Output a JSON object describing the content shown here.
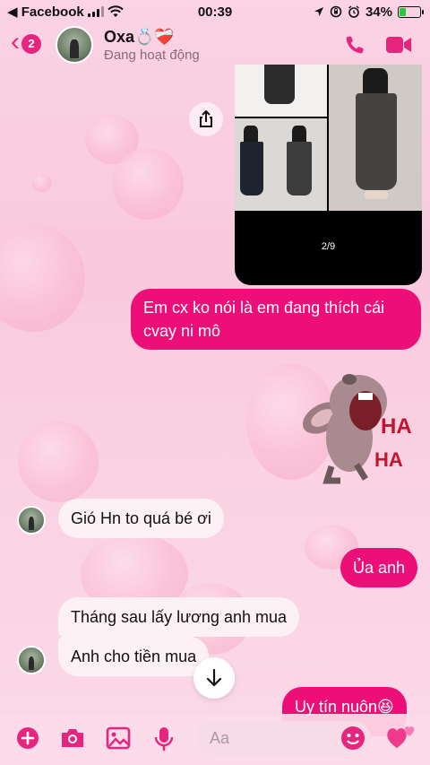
{
  "status_bar": {
    "back_app": "◀ Facebook",
    "time": "00:39",
    "battery": "34%",
    "battery_level": 0.34
  },
  "header": {
    "unread_count": "2",
    "name": "Oxa💍❤️‍🩹",
    "status": "Đang hoạt động"
  },
  "shared_image": {
    "page_indicator": "2/9"
  },
  "messages": [
    {
      "id": "m1",
      "side": "out",
      "text": "Em cx ko nói là em đang thích cái\ncvay ni mô"
    },
    {
      "id": "m2",
      "side": "out",
      "type": "sticker",
      "sticker_text": "HA HA"
    },
    {
      "id": "m3",
      "side": "in",
      "text": "Gió Hn to quá bé ơi"
    },
    {
      "id": "m4",
      "side": "out",
      "text": "Ủa anh"
    },
    {
      "id": "m5",
      "side": "in",
      "text": "Tháng sau lấy lương anh mua"
    },
    {
      "id": "m6",
      "side": "in",
      "text": "Anh cho tiền mua"
    },
    {
      "id": "m7",
      "side": "out",
      "text": "Uy tín nuôn😆"
    }
  ],
  "composer": {
    "placeholder": "Aa"
  },
  "colors": {
    "accent": "#e8257e",
    "outgoing_bubble": "#ee0e78",
    "incoming_bubble": "#fdf1f5"
  },
  "icons": [
    "back-chevron-icon",
    "phone-icon",
    "video-camera-icon",
    "share-icon",
    "scroll-down-arrow-icon",
    "plus-icon",
    "camera-icon",
    "gallery-icon",
    "microphone-icon",
    "emoji-icon",
    "heart-like-icon"
  ]
}
